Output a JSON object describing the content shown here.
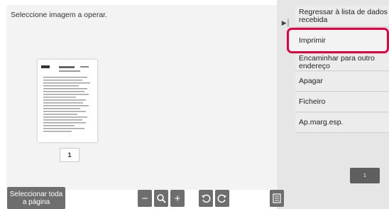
{
  "main": {
    "instruction": "Seleccione imagem a operar.",
    "thumbnail_page_label": "1"
  },
  "menu": {
    "items": [
      {
        "label": "Regressar à lista de dados recebida"
      },
      {
        "label": "Imprimir"
      },
      {
        "label": "Encaminhar para outro endereço"
      },
      {
        "label": "Apagar"
      },
      {
        "label": "Ficheiro"
      },
      {
        "label": "Ap.marg.esp."
      }
    ],
    "highlight_color": "#e5003f"
  },
  "bottom": {
    "select_all_label": "Seleccionar toda a página",
    "page_indicator": "1",
    "tools": [
      "zoom-out-icon",
      "magnifier-icon",
      "zoom-in-icon",
      "rotate-left-icon",
      "rotate-right-icon",
      "document-list-icon"
    ]
  }
}
